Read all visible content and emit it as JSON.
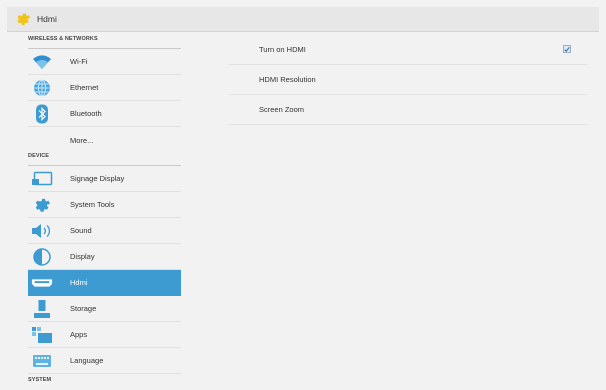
{
  "titlebar": {
    "title": "Hdmi",
    "icon": "gear-icon"
  },
  "sidebar": {
    "sections": [
      {
        "label": "WIRELESS & NETWORKS"
      },
      {
        "label": "DEVICE"
      },
      {
        "label": "SYSTEM"
      }
    ],
    "items": [
      {
        "label": "Wi-Fi",
        "icon": "wifi-icon"
      },
      {
        "label": "Ethernet",
        "icon": "globe-icon"
      },
      {
        "label": "Bluetooth",
        "icon": "bluetooth-icon"
      },
      {
        "label": "More...",
        "icon": ""
      },
      {
        "label": "Signage Display",
        "icon": "display-icon"
      },
      {
        "label": "System Tools",
        "icon": "gear-icon"
      },
      {
        "label": "Sound",
        "icon": "speaker-icon"
      },
      {
        "label": "Display",
        "icon": "brightness-icon"
      },
      {
        "label": "Hdmi",
        "icon": "hdmi-icon",
        "active": true
      },
      {
        "label": "Storage",
        "icon": "storage-icon"
      },
      {
        "label": "Apps",
        "icon": "apps-icon"
      },
      {
        "label": "Language",
        "icon": "keyboard-icon"
      }
    ]
  },
  "main": {
    "rows": [
      {
        "label": "Turn on HDMI",
        "checked": true
      },
      {
        "label": "HDMI Resolution"
      },
      {
        "label": "Screen Zoom"
      }
    ]
  },
  "colors": {
    "accent": "#3d9bd2",
    "icon_blue": "#2f8fd0",
    "background": "#f2f2f2"
  }
}
